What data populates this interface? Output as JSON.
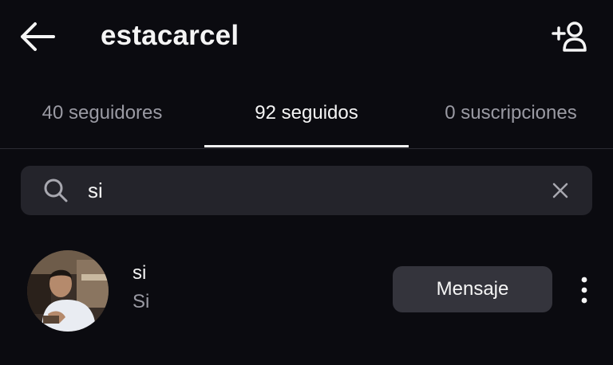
{
  "header": {
    "title": "estacarcel",
    "back_icon": "arrow-left-icon",
    "add_user_icon": "add-person-icon"
  },
  "tabs": [
    {
      "label": "40 seguidores",
      "active": false
    },
    {
      "label": "92 seguidos",
      "active": true
    },
    {
      "label": "0 suscripciones",
      "active": false
    }
  ],
  "search": {
    "value": "si",
    "icon": "search-icon",
    "clear_icon": "close-icon"
  },
  "results": [
    {
      "username": "si",
      "full_name": "Si",
      "action_label": "Mensaje",
      "more_icon": "more-vertical-icon"
    }
  ],
  "colors": {
    "background": "#0b0b10",
    "search_bg": "#24242b",
    "button_bg": "#34343c",
    "text_primary": "#f5f5f5",
    "text_secondary": "#9a9aa3"
  }
}
